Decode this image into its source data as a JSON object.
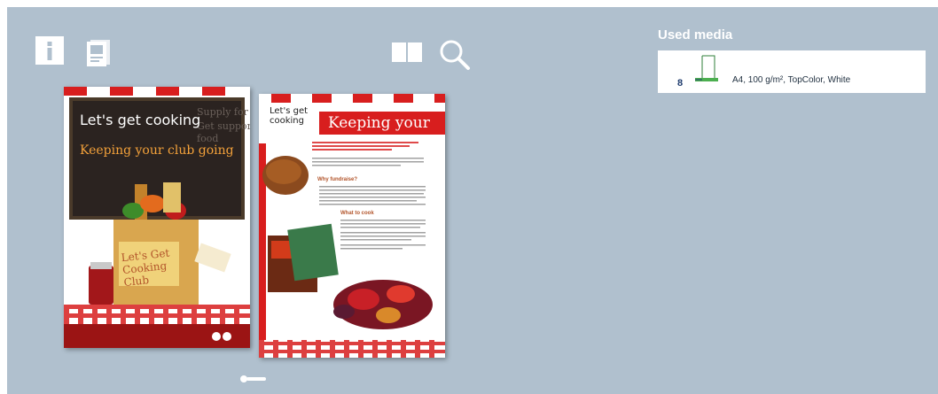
{
  "toolbar": {
    "info_icon": "info-icon",
    "document_icon": "document-icon",
    "book_view_icon": "book-view-icon",
    "zoom_icon": "zoom-icon"
  },
  "used_media": {
    "title": "Used media",
    "count": "8",
    "description": "A4, 100 g/m², TopColor, White"
  },
  "pages": {
    "left": {
      "brand": "Let's get cooking",
      "headline": "Keeping your club going",
      "bag_text": "Let's Get Cooking Club"
    },
    "right": {
      "brand": "Let's get cooking",
      "heading": "Keeping your",
      "sub1": "Why fundraise?",
      "sub2": "What to cook"
    }
  },
  "colors": {
    "background": "#b0c0ce",
    "accent_red": "#d81e1e",
    "chalkboard": "#2b2320",
    "white": "#ffffff"
  }
}
